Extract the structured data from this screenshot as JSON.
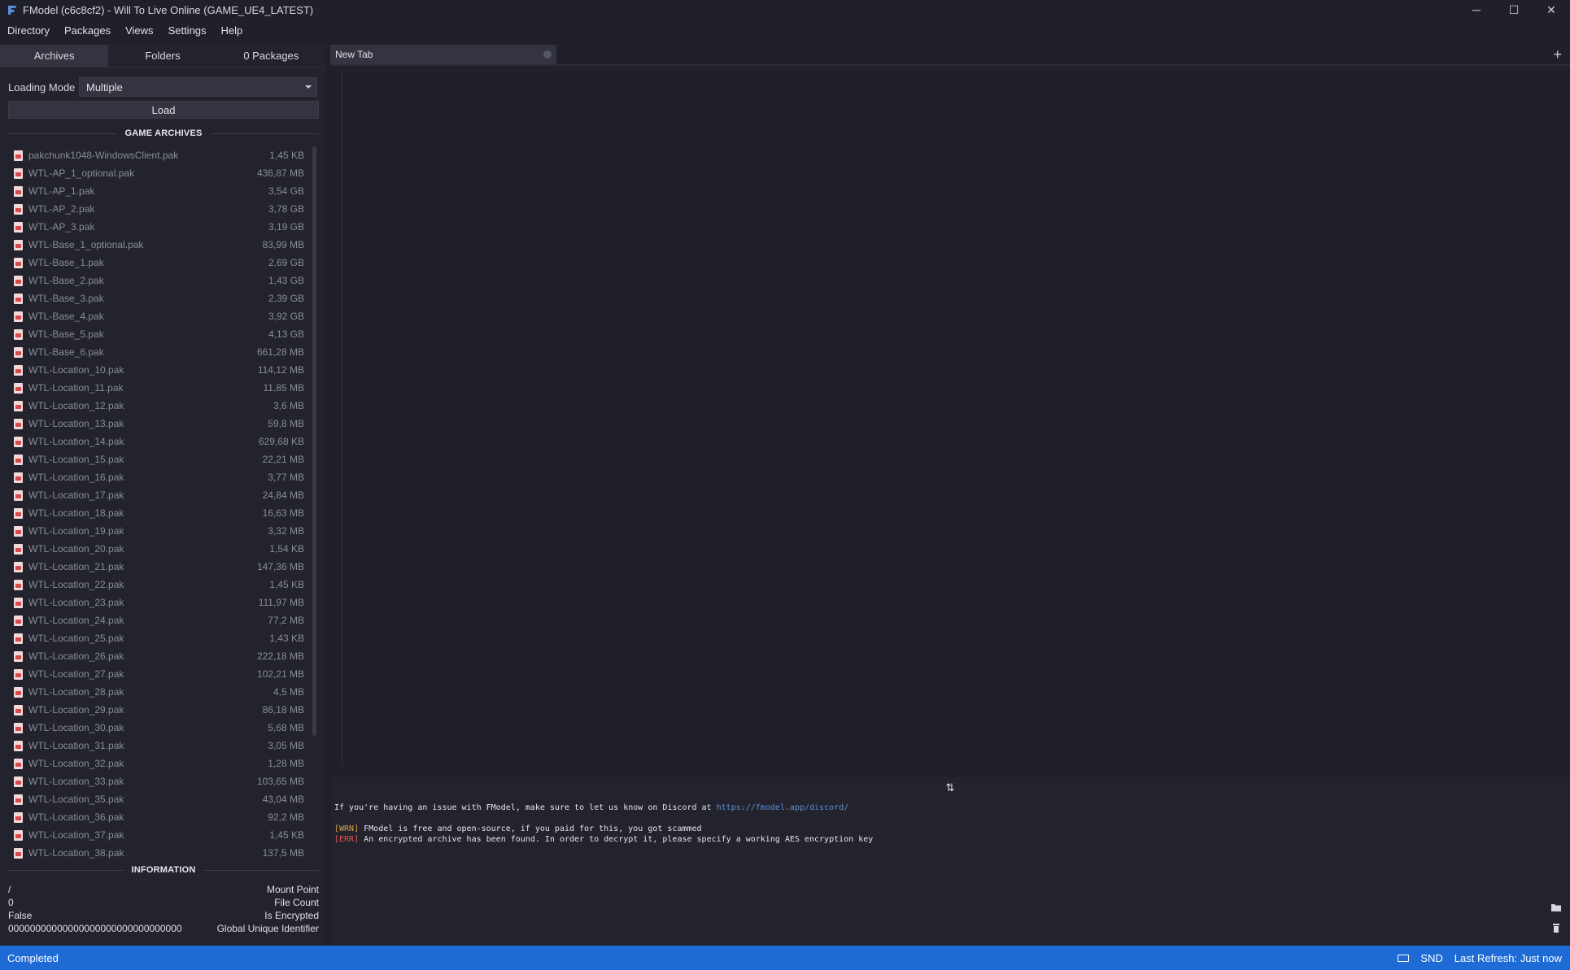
{
  "window": {
    "title": "FModel (c6c8cf2) - Will To Live Online (GAME_UE4_LATEST)",
    "controls": [
      "─",
      "☐",
      "✕"
    ]
  },
  "menu": [
    "Directory",
    "Packages",
    "Views",
    "Settings",
    "Help"
  ],
  "left_tabs": [
    {
      "label": "Archives",
      "active": true
    },
    {
      "label": "Folders",
      "active": false
    },
    {
      "label": "0 Packages",
      "active": false
    }
  ],
  "loading_mode": {
    "label": "Loading Mode",
    "value": "Multiple"
  },
  "load_button": "Load",
  "game_archives_title": "GAME ARCHIVES",
  "archives": [
    {
      "name": "pakchunk1048-WindowsClient.pak",
      "size": "1,45 KB"
    },
    {
      "name": "WTL-AP_1_optional.pak",
      "size": "436,87 MB"
    },
    {
      "name": "WTL-AP_1.pak",
      "size": "3,54 GB"
    },
    {
      "name": "WTL-AP_2.pak",
      "size": "3,78 GB"
    },
    {
      "name": "WTL-AP_3.pak",
      "size": "3,19 GB"
    },
    {
      "name": "WTL-Base_1_optional.pak",
      "size": "83,99 MB"
    },
    {
      "name": "WTL-Base_1.pak",
      "size": "2,69 GB"
    },
    {
      "name": "WTL-Base_2.pak",
      "size": "1,43 GB"
    },
    {
      "name": "WTL-Base_3.pak",
      "size": "2,39 GB"
    },
    {
      "name": "WTL-Base_4.pak",
      "size": "3,92 GB"
    },
    {
      "name": "WTL-Base_5.pak",
      "size": "4,13 GB"
    },
    {
      "name": "WTL-Base_6.pak",
      "size": "661,28 MB"
    },
    {
      "name": "WTL-Location_10.pak",
      "size": "114,12 MB"
    },
    {
      "name": "WTL-Location_11.pak",
      "size": "11,85 MB"
    },
    {
      "name": "WTL-Location_12.pak",
      "size": "3,6 MB"
    },
    {
      "name": "WTL-Location_13.pak",
      "size": "59,8 MB"
    },
    {
      "name": "WTL-Location_14.pak",
      "size": "629,68 KB"
    },
    {
      "name": "WTL-Location_15.pak",
      "size": "22,21 MB"
    },
    {
      "name": "WTL-Location_16.pak",
      "size": "3,77 MB"
    },
    {
      "name": "WTL-Location_17.pak",
      "size": "24,84 MB"
    },
    {
      "name": "WTL-Location_18.pak",
      "size": "16,63 MB"
    },
    {
      "name": "WTL-Location_19.pak",
      "size": "3,32 MB"
    },
    {
      "name": "WTL-Location_20.pak",
      "size": "1,54 KB"
    },
    {
      "name": "WTL-Location_21.pak",
      "size": "147,36 MB"
    },
    {
      "name": "WTL-Location_22.pak",
      "size": "1,45 KB"
    },
    {
      "name": "WTL-Location_23.pak",
      "size": "111,97 MB"
    },
    {
      "name": "WTL-Location_24.pak",
      "size": "77,2 MB"
    },
    {
      "name": "WTL-Location_25.pak",
      "size": "1,43 KB"
    },
    {
      "name": "WTL-Location_26.pak",
      "size": "222,18 MB"
    },
    {
      "name": "WTL-Location_27.pak",
      "size": "102,21 MB"
    },
    {
      "name": "WTL-Location_28.pak",
      "size": "4,5 MB"
    },
    {
      "name": "WTL-Location_29.pak",
      "size": "86,18 MB"
    },
    {
      "name": "WTL-Location_30.pak",
      "size": "5,68 MB"
    },
    {
      "name": "WTL-Location_31.pak",
      "size": "3,05 MB"
    },
    {
      "name": "WTL-Location_32.pak",
      "size": "1,28 MB"
    },
    {
      "name": "WTL-Location_33.pak",
      "size": "103,65 MB"
    },
    {
      "name": "WTL-Location_35.pak",
      "size": "43,04 MB"
    },
    {
      "name": "WTL-Location_36.pak",
      "size": "92,2 MB"
    },
    {
      "name": "WTL-Location_37.pak",
      "size": "1,45 KB"
    },
    {
      "name": "WTL-Location_38.pak",
      "size": "137,5 MB"
    }
  ],
  "information_title": "INFORMATION",
  "information": [
    {
      "value": "/",
      "label": "Mount Point"
    },
    {
      "value": "0",
      "label": "File Count"
    },
    {
      "value": "False",
      "label": "Is Encrypted"
    },
    {
      "value": "00000000000000000000000000000000",
      "label": "Global Unique Identifier"
    }
  ],
  "doc_tab": {
    "label": "New Tab"
  },
  "add_tab": "+",
  "splitter_icon": "⇅",
  "console": {
    "intro": "If you're having an issue with FModel, make sure to let us know on Discord at ",
    "link": "https://fmodel.app/discord/",
    "wrn_tag": "[WRN]",
    "wrn_text": " FModel is free and open-source, if you paid for this, you got scammed",
    "err_tag": "[ERR]",
    "err_text": " An encrypted archive has been found. In order to decrypt it, please specify a working AES encryption key"
  },
  "status": {
    "left": "Completed",
    "snd": "SND",
    "last_refresh": "Last Refresh: Just now"
  },
  "colors": {
    "status_bar": "#1e6bd6",
    "background": "#1f2029",
    "link": "#5e8fd6",
    "warn": "#e0a34a",
    "error": "#e05656"
  }
}
